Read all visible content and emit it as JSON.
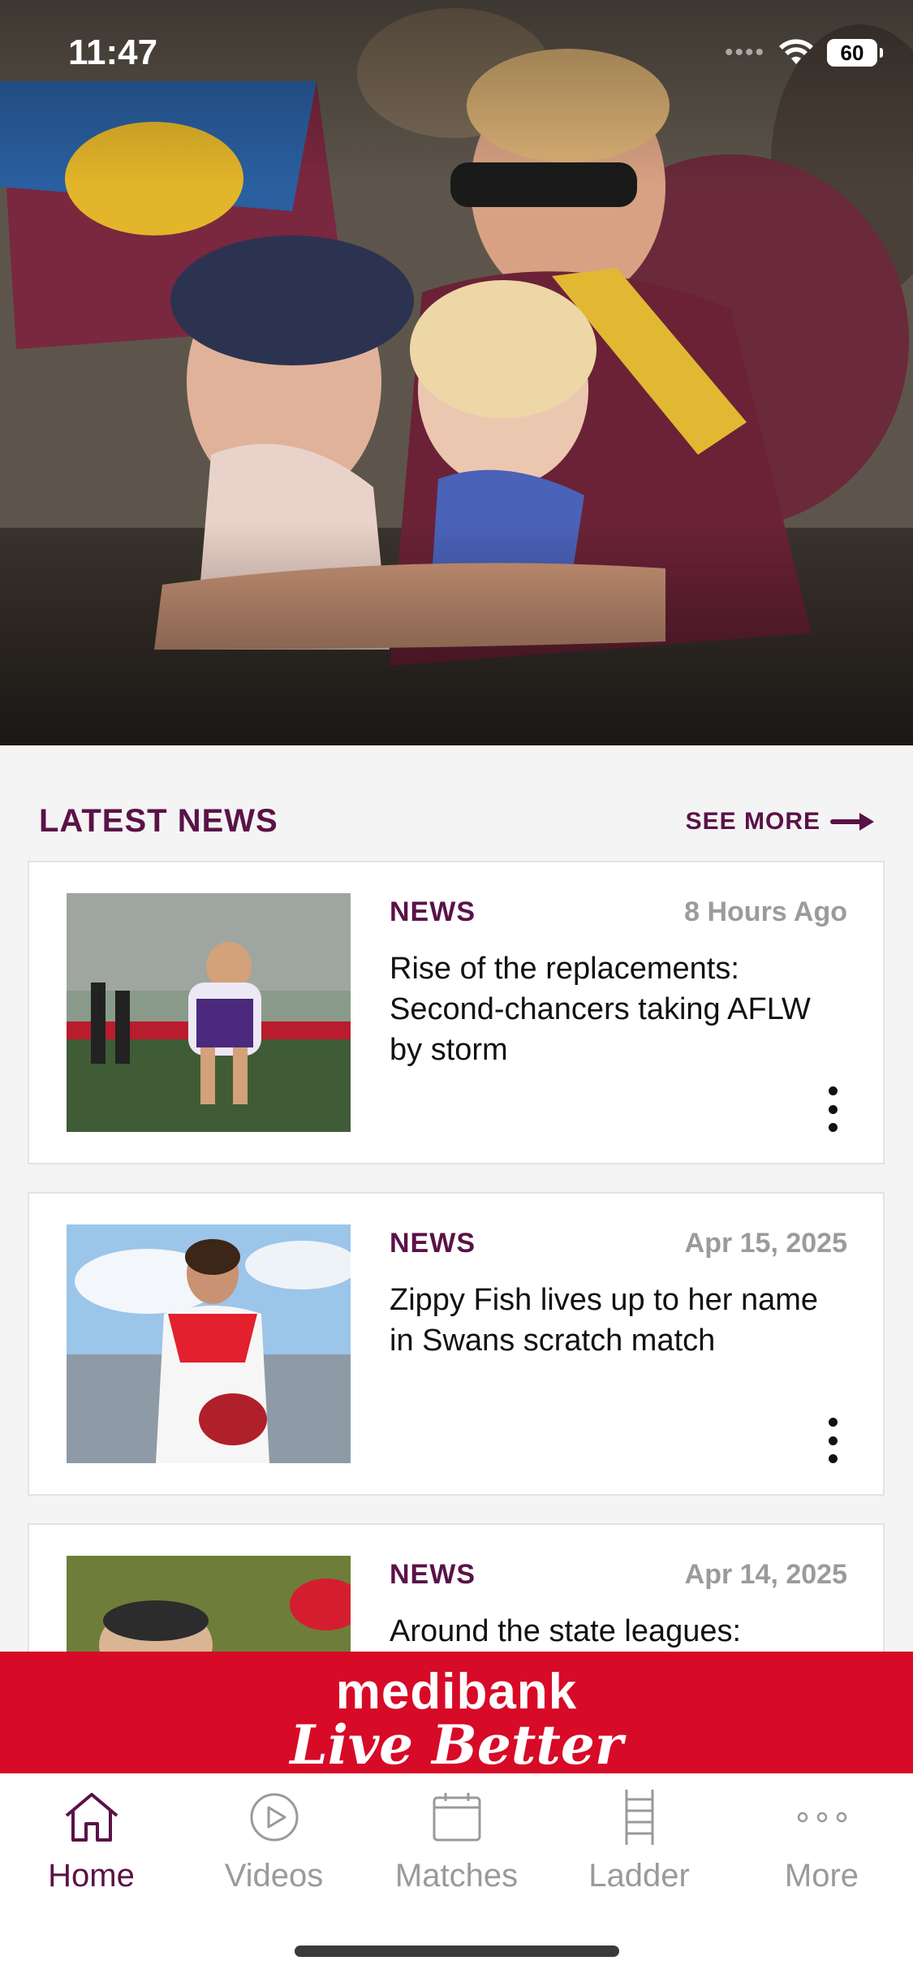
{
  "status_bar": {
    "time": "11:47",
    "signal_text": "••••",
    "battery": "60"
  },
  "colors": {
    "brand": "#5a1247",
    "ad_red": "#d70a27",
    "inactive": "#9a9a9a"
  },
  "latest_news": {
    "title": "LATEST NEWS",
    "see_more": "SEE MORE",
    "items": [
      {
        "category": "NEWS",
        "date": "8 Hours Ago",
        "headline": "Rise of the replacements: Second-chancers taking AFLW by storm"
      },
      {
        "category": "NEWS",
        "date": "Apr 15, 2025",
        "headline": "Zippy Fish lives up to her name in Swans scratch match"
      },
      {
        "category": "NEWS",
        "date": "Apr 14, 2025",
        "headline": "Around the state leagues:"
      }
    ]
  },
  "ad": {
    "line1": "medibank",
    "line2": "Live Better"
  },
  "tabs": [
    {
      "label": "Home",
      "icon": "home-icon",
      "active": true
    },
    {
      "label": "Videos",
      "icon": "play-icon",
      "active": false
    },
    {
      "label": "Matches",
      "icon": "calendar-icon",
      "active": false
    },
    {
      "label": "Ladder",
      "icon": "ladder-icon",
      "active": false
    },
    {
      "label": "More",
      "icon": "more-dots-icon",
      "active": false
    }
  ]
}
